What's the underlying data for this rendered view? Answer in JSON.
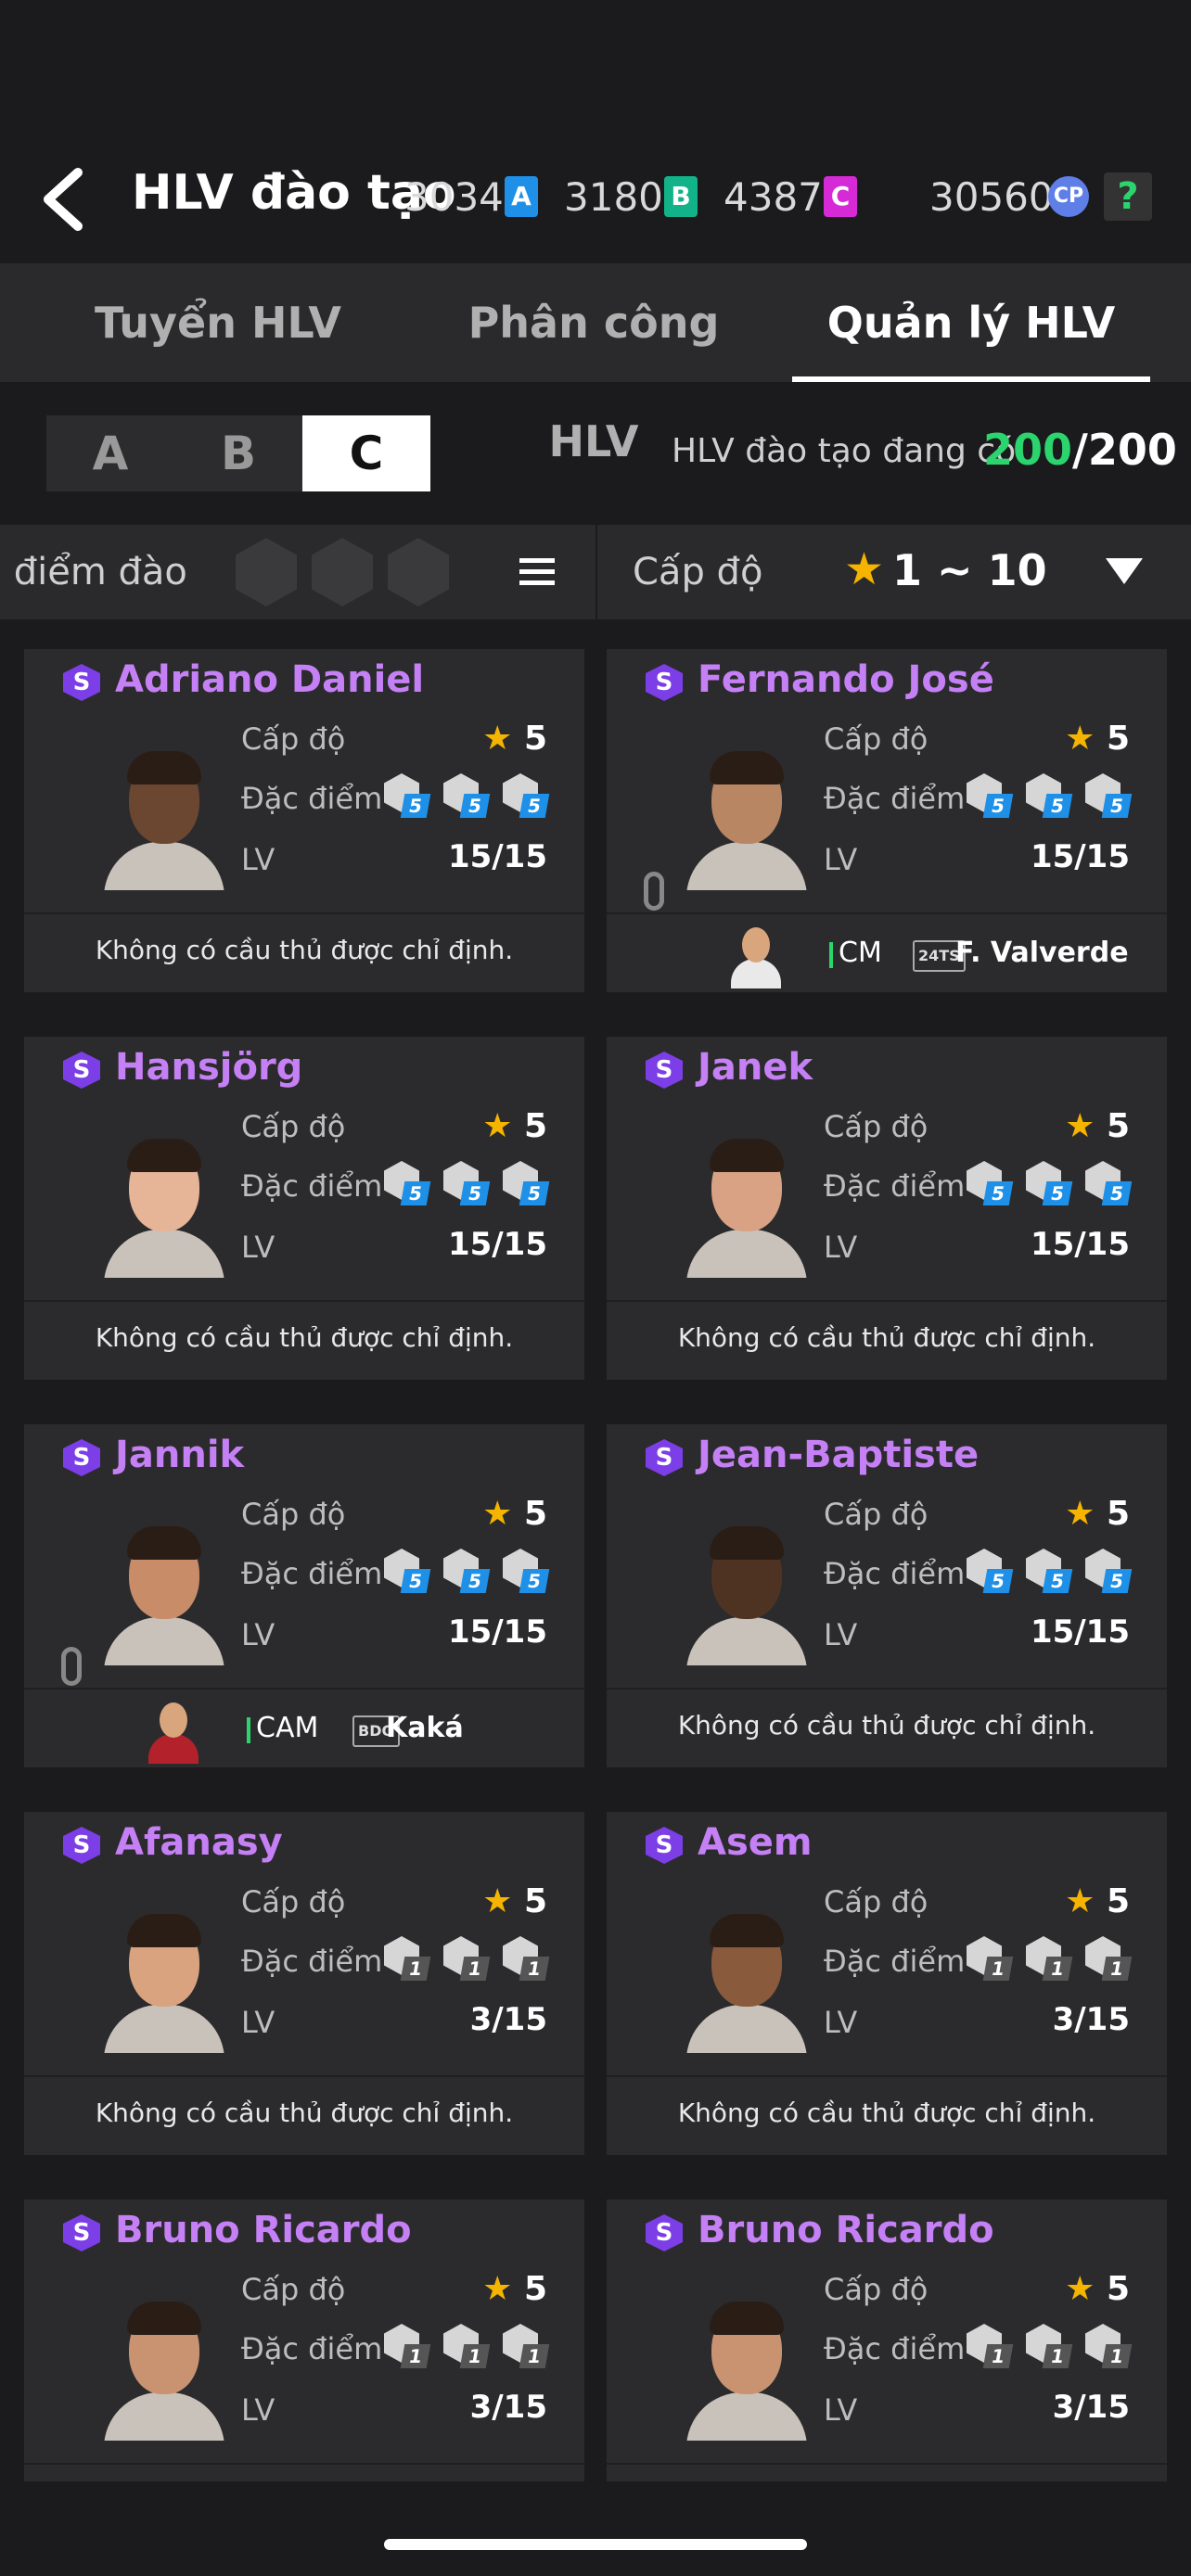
{
  "header": {
    "title": "HLV đào tạo",
    "currencies": [
      {
        "value": "3034",
        "badge": "A",
        "color": "#1e90e8"
      },
      {
        "value": "3180",
        "badge": "B",
        "color": "#13b38a"
      },
      {
        "value": "4387",
        "badge": "C",
        "color": "#d62ad6"
      }
    ],
    "cp_value": "30560",
    "cp_label": "CP",
    "help": "?"
  },
  "tabs": [
    {
      "label": "Tuyển HLV",
      "active": false
    },
    {
      "label": "Phân công HLV",
      "active": false
    },
    {
      "label": "Quản lý HLV",
      "active": true
    }
  ],
  "segment": {
    "options": [
      "A",
      "B",
      "C"
    ],
    "selected": "C"
  },
  "count": {
    "label": "HLV đào tạo đang có",
    "current": "200",
    "max": "/200"
  },
  "filter": {
    "trait_label": "c điểm đào",
    "level_label": "Cấp độ",
    "level_range": "1 ~ 10"
  },
  "labels": {
    "level": "Cấp độ",
    "trait": "Đặc điểm",
    "lv": "LV",
    "no_player": "Không có cầu thủ được chỉ định.",
    "rank": "S"
  },
  "coaches": [
    {
      "name": "Adriano Daniel",
      "level": "5",
      "lv": "15/15",
      "traits": [
        "5",
        "5",
        "5"
      ],
      "skin": "#6b4630",
      "assigned": null
    },
    {
      "name": "Fernando José",
      "level": "5",
      "lv": "15/15",
      "traits": [
        "5",
        "5",
        "5"
      ],
      "skin": "#b98664",
      "assigned": {
        "position": "CM",
        "season": "24TS",
        "player": "F. Valverde",
        "kit": "#e9e9e9"
      }
    },
    {
      "name": "Hansjörg",
      "level": "5",
      "lv": "15/15",
      "traits": [
        "5",
        "5",
        "5"
      ],
      "skin": "#e6b497",
      "assigned": null
    },
    {
      "name": "Janek",
      "level": "5",
      "lv": "15/15",
      "traits": [
        "5",
        "5",
        "5"
      ],
      "skin": "#d9a285",
      "assigned": null
    },
    {
      "name": "Jannik",
      "level": "5",
      "lv": "15/15",
      "traits": [
        "5",
        "5",
        "5"
      ],
      "skin": "#c98c69",
      "assigned": {
        "position": "CAM",
        "season": "BDO",
        "player": "Kaká",
        "kit": "#b3222b"
      }
    },
    {
      "name": "Jean-Baptiste",
      "level": "5",
      "lv": "15/15",
      "traits": [
        "5",
        "5",
        "5"
      ],
      "skin": "#4e3323",
      "assigned": null
    },
    {
      "name": "Afanasy",
      "level": "5",
      "lv": "3/15",
      "traits": [
        "1",
        "1",
        "1"
      ],
      "skin": "#d8a37e",
      "assigned": null
    },
    {
      "name": "Asem",
      "level": "5",
      "lv": "3/15",
      "traits": [
        "1",
        "1",
        "1"
      ],
      "skin": "#8a5a3c",
      "assigned": null
    },
    {
      "name": "Bruno Ricardo",
      "level": "5",
      "lv": "3/15",
      "traits": [
        "1",
        "1",
        "1"
      ],
      "skin": "#c99372",
      "assigned": null
    },
    {
      "name": "Bruno Ricardo",
      "level": "5",
      "lv": "3/15",
      "traits": [
        "1",
        "1",
        "1"
      ],
      "skin": "#c99372",
      "assigned": null
    }
  ]
}
